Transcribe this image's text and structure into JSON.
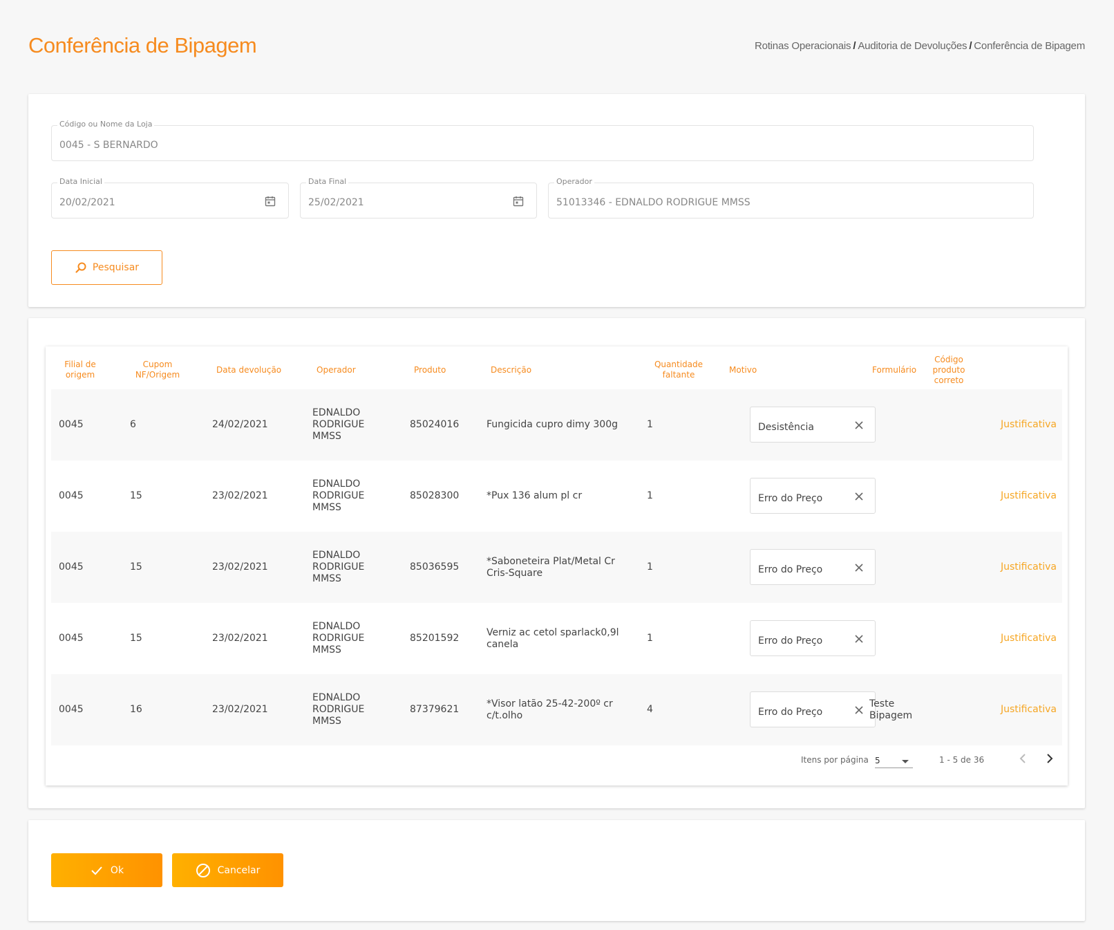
{
  "page": {
    "title": "Conferência de Bipagem",
    "breadcrumb": [
      "Rotinas Operacionais",
      "Auditoria de Devoluções",
      "Conferência de Bipagem"
    ],
    "breadcrumb_sep": "/"
  },
  "filters": {
    "loja": {
      "label": "Código ou Nome da Loja",
      "value": "0045 - S BERNARDO"
    },
    "data_inicial": {
      "label": "Data Inicial",
      "value": "20/02/2021"
    },
    "data_final": {
      "label": "Data Final",
      "value": "25/02/2021"
    },
    "operador": {
      "label": "Operador",
      "value": "51013346 - EDNALDO RODRIGUE MMSS"
    },
    "search_button": "Pesquisar"
  },
  "table": {
    "headers": {
      "filial": [
        "Filial de",
        "origem"
      ],
      "cupom": [
        "Cupom",
        "NF/Origem"
      ],
      "data": [
        "Data devolução"
      ],
      "operador": [
        "Operador"
      ],
      "produto": [
        "Produto"
      ],
      "descricao": [
        "Descrição"
      ],
      "quantidade": [
        "Quantidade",
        "faltante"
      ],
      "motivo": [
        "Motivo"
      ],
      "formulario": [
        "Formulário"
      ],
      "codigo": [
        "Código",
        "produto",
        "correto"
      ]
    },
    "rows": [
      {
        "filial": "0045",
        "cupom": "6",
        "data": "24/02/2021",
        "operador": [
          "EDNALDO",
          "RODRIGUE",
          "MMSS"
        ],
        "produto": "85024016",
        "descricao": [
          "Fungicida cupro dimy 300g"
        ],
        "quantidade": "1",
        "motivo": "Desistência",
        "formulario": [],
        "codigo": "",
        "acao": "Justificativa"
      },
      {
        "filial": "0045",
        "cupom": "15",
        "data": "23/02/2021",
        "operador": [
          "EDNALDO",
          "RODRIGUE",
          "MMSS"
        ],
        "produto": "85028300",
        "descricao": [
          "*Pux 136 alum pl cr"
        ],
        "quantidade": "1",
        "motivo": "Erro do Preço",
        "formulario": [],
        "codigo": "",
        "acao": "Justificativa"
      },
      {
        "filial": "0045",
        "cupom": "15",
        "data": "23/02/2021",
        "operador": [
          "EDNALDO",
          "RODRIGUE",
          "MMSS"
        ],
        "produto": "85036595",
        "descricao": [
          "*Saboneteira Plat/Metal Cr",
          "Cris-Square"
        ],
        "quantidade": "1",
        "motivo": "Erro do Preço",
        "formulario": [],
        "codigo": "",
        "acao": "Justificativa"
      },
      {
        "filial": "0045",
        "cupom": "15",
        "data": "23/02/2021",
        "operador": [
          "EDNALDO",
          "RODRIGUE",
          "MMSS"
        ],
        "produto": "85201592",
        "descricao": [
          "Verniz ac cetol sparlack0,9l",
          "canela"
        ],
        "quantidade": "1",
        "motivo": "Erro do Preço",
        "formulario": [],
        "codigo": "",
        "acao": "Justificativa"
      },
      {
        "filial": "0045",
        "cupom": "16",
        "data": "23/02/2021",
        "operador": [
          "EDNALDO",
          "RODRIGUE",
          "MMSS"
        ],
        "produto": "87379621",
        "descricao": [
          "*Visor latão 25-42-200º cr",
          "c/t.olho"
        ],
        "quantidade": "4",
        "motivo": "Erro do Preço",
        "formulario": [
          "Teste",
          "Bipagem"
        ],
        "codigo": "",
        "acao": "Justificativa"
      }
    ],
    "paginator": {
      "items_label": "Itens por página",
      "page_size": "5",
      "range": "1 - 5 de 36"
    }
  },
  "actions": {
    "ok": "Ok",
    "cancel": "Cancelar"
  },
  "colors": {
    "accent": "#f68b1f",
    "link": "#f6a623",
    "button_gradient_start": "#ffb000",
    "button_gradient_end": "#ff9200"
  },
  "icons": {
    "search": "search-icon",
    "calendar": "calendar-icon",
    "clear": "close-icon",
    "prev": "chevron-left-icon",
    "next": "chevron-right-icon",
    "ok": "check-icon",
    "cancel": "cancel-icon",
    "select": "caret-down-icon"
  }
}
